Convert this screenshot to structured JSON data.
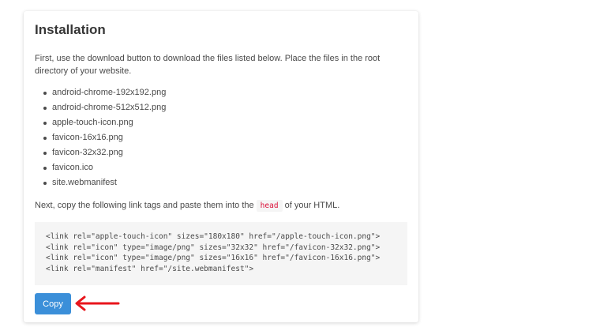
{
  "section": {
    "title": "Installation",
    "intro": "First, use the download button to download the files listed below. Place the files in the root directory of your website.",
    "files": [
      "android-chrome-192x192.png",
      "android-chrome-512x512.png",
      "apple-touch-icon.png",
      "favicon-16x16.png",
      "favicon-32x32.png",
      "favicon.ico",
      "site.webmanifest"
    ],
    "next_before": "Next, copy the following link tags and paste them into the ",
    "next_code": "head",
    "next_after": " of your HTML.",
    "code_lines": [
      "<link rel=\"apple-touch-icon\" sizes=\"180x180\" href=\"/apple-touch-icon.png\">",
      "<link rel=\"icon\" type=\"image/png\" sizes=\"32x32\" href=\"/favicon-32x32.png\">",
      "<link rel=\"icon\" type=\"image/png\" sizes=\"16x16\" href=\"/favicon-16x16.png\">",
      "<link rel=\"manifest\" href=\"/site.webmanifest\">"
    ],
    "copy_label": "Copy"
  },
  "annotation": {
    "arrow_icon": "red-arrow-left-icon",
    "arrow_color": "#e8161c"
  },
  "colors": {
    "button": "#3b8fd9",
    "inline_code": "#da1039",
    "code_background": "#f5f5f5"
  }
}
